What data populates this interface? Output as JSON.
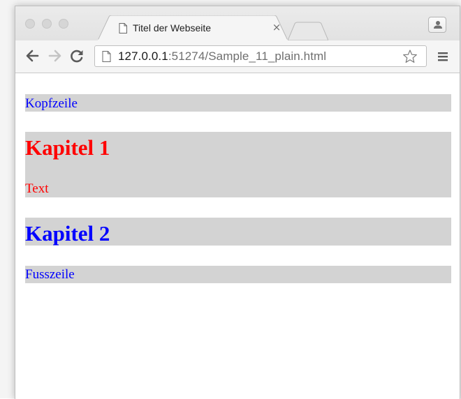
{
  "browser": {
    "tab": {
      "title": "Titel der Webseite",
      "close_glyph": "×"
    },
    "address_bar": {
      "url_host": "127.0.0.1",
      "url_rest": ":51274/Sample_11_plain.html"
    },
    "icons": {
      "back": "arrow-left-icon",
      "forward": "arrow-right-icon",
      "reload": "reload-icon",
      "page": "page-icon",
      "bookmark": "star-icon",
      "menu": "hamburger-menu-icon",
      "profile": "person-icon"
    }
  },
  "page": {
    "header": {
      "text": "Kopfzeile",
      "color": "#0000ff"
    },
    "chapter1": {
      "heading": "Kapitel 1",
      "body": "Text",
      "color": "#ff0000"
    },
    "chapter2": {
      "heading": "Kapitel 2",
      "color": "#0000ff"
    },
    "footer": {
      "text": "Fusszeile",
      "color": "#0000ff"
    },
    "block_background": "#d3d3d3"
  }
}
